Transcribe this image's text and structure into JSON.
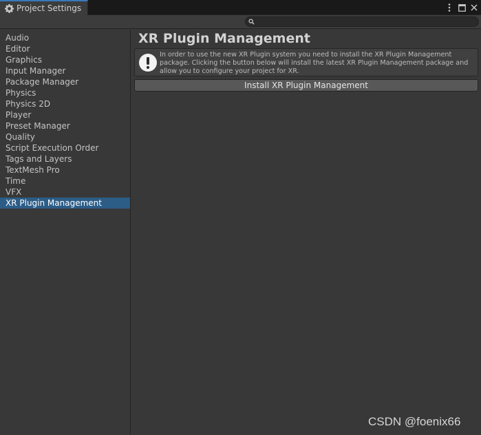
{
  "window": {
    "tab_title": "Project Settings"
  },
  "search": {
    "value": "",
    "placeholder": ""
  },
  "sidebar": {
    "items": [
      {
        "label": "Audio"
      },
      {
        "label": "Editor"
      },
      {
        "label": "Graphics"
      },
      {
        "label": "Input Manager"
      },
      {
        "label": "Package Manager"
      },
      {
        "label": "Physics"
      },
      {
        "label": "Physics 2D"
      },
      {
        "label": "Player"
      },
      {
        "label": "Preset Manager"
      },
      {
        "label": "Quality"
      },
      {
        "label": "Script Execution Order"
      },
      {
        "label": "Tags and Layers"
      },
      {
        "label": "TextMesh Pro"
      },
      {
        "label": "Time"
      },
      {
        "label": "VFX"
      },
      {
        "label": "XR Plugin Management",
        "selected": true
      }
    ]
  },
  "main": {
    "title": "XR Plugin Management",
    "help_text": "In order to use the new XR Plugin system you need to install the XR Plugin Management package. Clicking the button below will install the latest XR Plugin Management package and allow you to configure your project for XR.",
    "install_button_label": "Install XR Plugin Management"
  },
  "icons": {
    "tab": "gear-icon",
    "menu": "kebab-menu-icon",
    "maximize": "maximize-icon",
    "close": "close-icon",
    "search": "search-icon",
    "help": "warning-icon"
  },
  "colors": {
    "background": "#383838",
    "selection": "#2c5d87",
    "tab_accent": "#3a79bb"
  },
  "watermark": "CSDN @foenix66"
}
